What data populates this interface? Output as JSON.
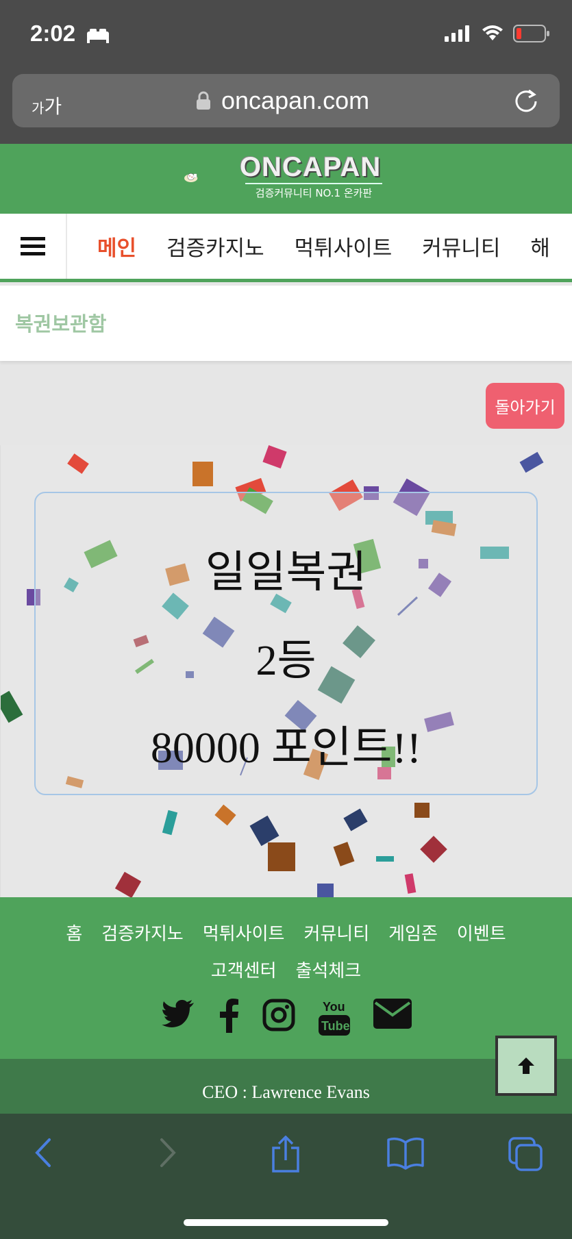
{
  "status_bar": {
    "time": "2:02"
  },
  "address_bar": {
    "text_size_label_small": "가",
    "text_size_label_large": "가",
    "domain": "oncapan.com"
  },
  "site": {
    "logo_text": "ONCAPAN",
    "logo_tagline": "검증커뮤니티 NO.1 온카판",
    "nav": [
      "메인",
      "검증카지노",
      "먹튀사이트",
      "커뮤니티",
      "해"
    ],
    "breadcrumb": "복권보관함",
    "back_button": "돌아가기",
    "accent_color": "#4fa35b",
    "active_nav_color": "#e8502c"
  },
  "result": {
    "line1": "일일복권",
    "line2": "2등",
    "line3": "80000 포인트!!"
  },
  "footer": {
    "links_row1": [
      "홈",
      "검증카지노",
      "먹튀사이트",
      "커뮤니티",
      "게임존",
      "이벤트"
    ],
    "links_row2": [
      "고객센터",
      "출석체크"
    ],
    "social": [
      "twitter-icon",
      "facebook-icon",
      "instagram-icon",
      "youtube-icon",
      "email-icon"
    ],
    "ceo": "CEO : Lawrence Evans"
  }
}
